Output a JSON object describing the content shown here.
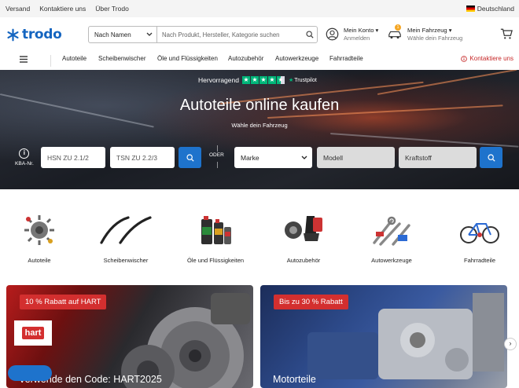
{
  "topbar": {
    "links": [
      "Versand",
      "Kontaktiere uns",
      "Über Trodo"
    ],
    "language": "Deutschland"
  },
  "header": {
    "logo": "trodo",
    "search": {
      "select_value": "Nach Namen",
      "placeholder": "Nach Produkt, Hersteller, Kategorie suchen"
    },
    "account": {
      "title": "Mein Konto",
      "subtitle": "Anmelden"
    },
    "vehicle": {
      "title": "Mein Fahrzeug",
      "subtitle": "Wähle dein Fahrzeug",
      "badge": "1"
    }
  },
  "nav": {
    "items": [
      "Autoteile",
      "Scheibenwischer",
      "Öle und Flüssigkeiten",
      "Autozubehör",
      "Autowerkzeuge",
      "Fahrradteile"
    ],
    "contact": "Kontaktiere uns"
  },
  "hero": {
    "trust_label": "Hervorragend",
    "trust_brand": "Trustpilot",
    "title": "Autoteile online kaufen",
    "subtitle": "Wähle dein Fahrzeug",
    "kba_label": "KBA-Nr.",
    "hsn_placeholder": "HSN ZU 2.1/2",
    "tsn_placeholder": "TSN ZU 2.2/3",
    "or_label": "ODER",
    "brand_select": "Marke",
    "model_select": "Modell",
    "fuel_select": "Kraftstoff"
  },
  "categories": [
    {
      "label": "Autoteile",
      "icon": "engine-parts-icon"
    },
    {
      "label": "Scheibenwischer",
      "icon": "wiper-icon"
    },
    {
      "label": "Öle und Flüssigkeiten",
      "icon": "oil-icon"
    },
    {
      "label": "Autozubehör",
      "icon": "seat-icon"
    },
    {
      "label": "Autowerkzeuge",
      "icon": "tools-icon"
    },
    {
      "label": "Fahrradteile",
      "icon": "bicycle-icon"
    }
  ],
  "promos": [
    {
      "badge": "10 % Rabatt auf HART",
      "title": "Verwende den Code: HART2025",
      "brand": "hart"
    },
    {
      "badge": "Bis zu 30 % Rabatt",
      "title": "Motorteile"
    }
  ],
  "colors": {
    "brand": "#1565c0",
    "accent": "#1e73cc",
    "sale": "#d32f2f",
    "trustpilot": "#00b67a"
  }
}
